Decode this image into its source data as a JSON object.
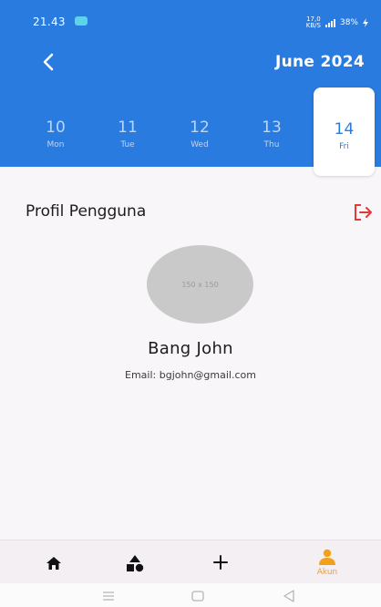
{
  "status_bar": {
    "time": "21.43",
    "net_speed": "17,0",
    "net_unit": "KB/S",
    "battery": "38%"
  },
  "header": {
    "month_label": "June 2024",
    "days": [
      {
        "num": "10",
        "dow": "Mon"
      },
      {
        "num": "11",
        "dow": "Tue"
      },
      {
        "num": "12",
        "dow": "Wed"
      },
      {
        "num": "13",
        "dow": "Thu"
      }
    ],
    "selected_day": {
      "num": "14",
      "dow": "Fri"
    }
  },
  "profile": {
    "section_title": "Profil Pengguna",
    "avatar_placeholder": "150 x 150",
    "name": "Bang John",
    "email": "Email: bgjohn@gmail.com"
  },
  "bottom_nav": {
    "active_label": "Akun",
    "items": [
      "home-icon",
      "shapes-icon",
      "plus-icon",
      "person-icon"
    ]
  },
  "colors": {
    "header_bg": "#2a7be0",
    "accent_orange": "#f2a11a",
    "logout_red": "#e53935"
  }
}
